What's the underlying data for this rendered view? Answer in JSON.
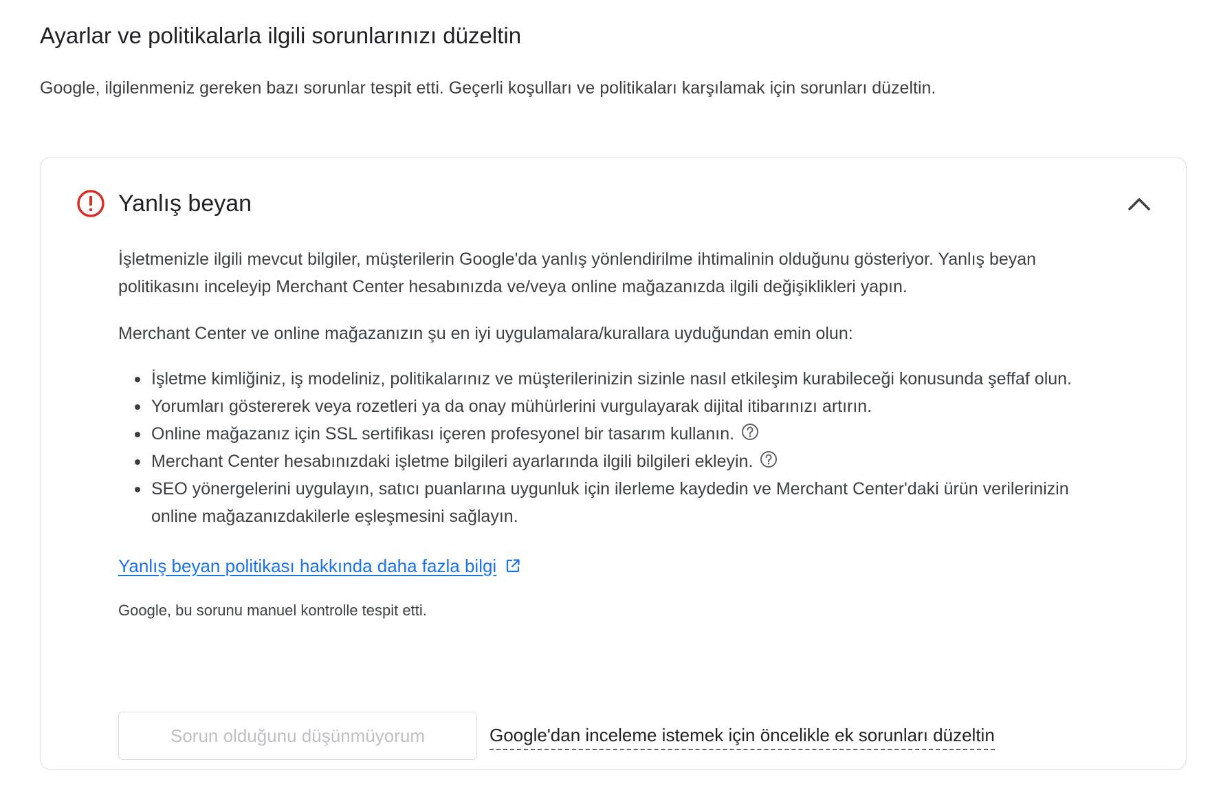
{
  "page": {
    "title": "Ayarlar ve politikalarla ilgili sorunlarınızı düzeltin",
    "description": "Google, ilgilenmeniz gereken bazı sorunlar tespit etti. Geçerli koşulları ve politikaları karşılamak için sorunları düzeltin."
  },
  "issue_card": {
    "title": "Yanlış beyan",
    "status_color": "#d93025",
    "expanded": true,
    "paragraphs": [
      "İşletmenizle ilgili mevcut bilgiler, müşterilerin Google'da yanlış yönlendirilme ihtimalinin olduğunu gösteriyor. Yanlış beyan politikasını inceleyip Merchant Center hesabınızda ve/veya online mağazanızda ilgili değişiklikleri yapın.",
      "Merchant Center ve online mağazanızın şu en iyi uygulamalara/kurallara uyduğundan emin olun:"
    ],
    "recommendations": [
      {
        "text": "İşletme kimliğiniz, iş modeliniz, politikalarınız ve müşterilerinizin sizinle nasıl etkileşim kurabileceği konusunda şeffaf olun.",
        "has_help": false
      },
      {
        "text": "Yorumları göstererek veya rozetleri ya da onay mühürlerini vurgulayarak dijital itibarınızı artırın.",
        "has_help": false
      },
      {
        "text": "Online mağazanız için SSL sertifikası içeren profesyonel bir tasarım kullanın.",
        "has_help": true
      },
      {
        "text": "Merchant Center hesabınızdaki işletme bilgileri ayarlarında ilgili bilgileri ekleyin.",
        "has_help": true
      },
      {
        "text": "SEO yönergelerini uygulayın, satıcı puanlarına uygunluk için ilerleme kaydedin ve Merchant Center'daki ürün verilerinizin online mağazanızdakilerle eşleşmesini sağlayın.",
        "has_help": false
      }
    ],
    "learn_more_link": "Yanlış beyan politikası hakkında daha fazla bilgi",
    "link_color": "#1a73e8",
    "detection_note": "Google, bu sorunu manuel kontrolle tespit etti.",
    "dispute_button": "Sorun olduğunu düşünmüyorum",
    "review_hint": "Google'dan inceleme istemek için öncelikle ek sorunları düzeltin",
    "icons": {
      "status": "error-circle-icon",
      "collapse": "chevron-up-icon",
      "help": "help-circle-icon",
      "external": "open-in-new-icon"
    }
  }
}
